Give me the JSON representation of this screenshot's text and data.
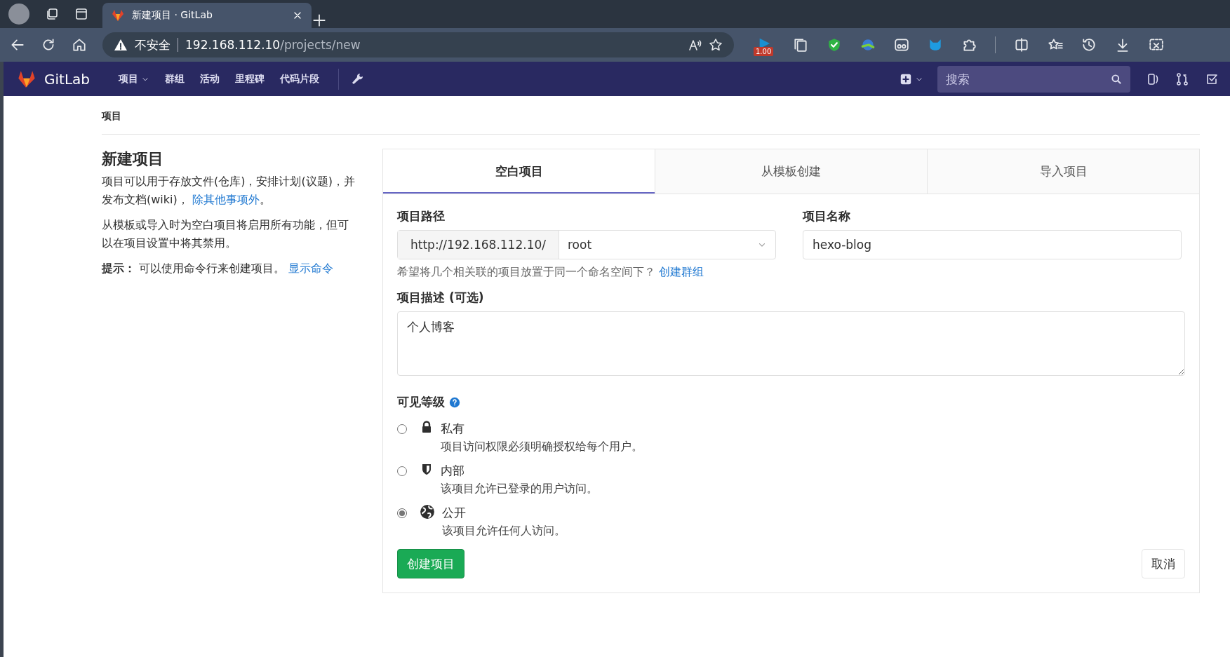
{
  "browser": {
    "tabs": [
      {
        "title": "新建项目 · GitLab",
        "selected": true
      }
    ],
    "address": {
      "warning": "不安全",
      "host": "192.168.112.10",
      "path": "/projects/new"
    },
    "extension_badge": "1.00"
  },
  "navbar": {
    "brand": "GitLab",
    "items": [
      {
        "label": "项目",
        "dropdown": true
      },
      {
        "label": "群组",
        "dropdown": false
      },
      {
        "label": "活动",
        "dropdown": false
      },
      {
        "label": "里程碑",
        "dropdown": false
      },
      {
        "label": "代码片段",
        "dropdown": false
      }
    ],
    "search": {
      "placeholder": "搜索"
    }
  },
  "breadcrumb": "项目",
  "intro": {
    "title": "新建项目",
    "paragraph_1": {
      "text": "项目可以用于存放文件(仓库)，安排计划(议题)，并发布文档(wiki)， ",
      "link": "除其他事项外",
      "after": "。"
    },
    "paragraph_2": "从模板或导入时为空白项目将启用所有功能，但可以在项目设置中将其禁用。",
    "tip": {
      "label": "提示：",
      "text": "可以使用命令行来创建项目。",
      "link": "显示命令"
    }
  },
  "form": {
    "tabs": [
      {
        "label": "空白项目",
        "selected": true
      },
      {
        "label": "从模板创建",
        "selected": false
      },
      {
        "label": "导入项目",
        "selected": false
      }
    ],
    "path_label": "项目路径",
    "url_prefix": "http://192.168.112.10/",
    "namespace": "root",
    "name_label": "项目名称",
    "name_value": "hexo-blog",
    "group_hint": {
      "text": "希望将几个相关联的项目放置于同一个命名空间下？",
      "link": "创建群组"
    },
    "description_label": "项目描述 (可选)",
    "description_value": "个人博客",
    "visibility_label": "可见等级",
    "visibility_options": [
      {
        "kind": "private",
        "title": "私有",
        "description": "项目访问权限必须明确授权给每个用户。",
        "selected": false
      },
      {
        "kind": "internal",
        "title": "内部",
        "description": "该项目允许已登录的用户访问。",
        "selected": false
      },
      {
        "kind": "public",
        "title": "公开",
        "description": "该项目允许任何人访问。",
        "selected": true
      }
    ],
    "create_button": "创建项目",
    "cancel_button": "取消"
  }
}
